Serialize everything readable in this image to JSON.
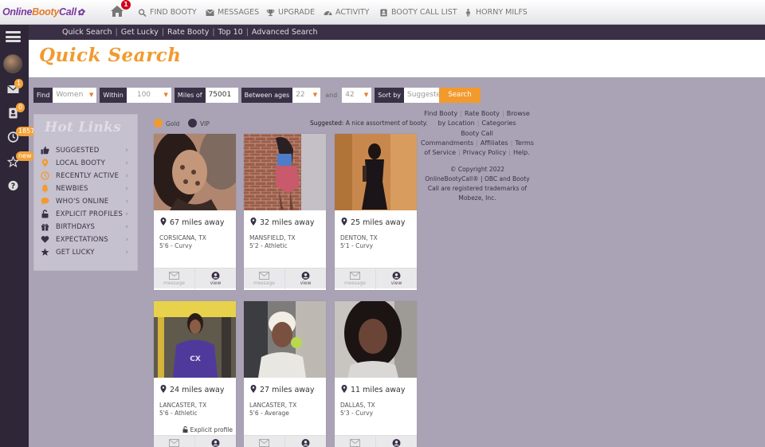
{
  "app": {
    "logo_part1": "Online",
    "logo_part2": "Booty",
    "logo_part3": "Call"
  },
  "topnav": {
    "home_badge": "1",
    "items": [
      "FIND BOOTY",
      "MESSAGES",
      "UPGRADE",
      "ACTIVITY",
      "BOOTY CALL LIST",
      "HORNY MILFS"
    ]
  },
  "sidebar": {
    "messages_badge": "1",
    "profile_badge": "0",
    "history_badge": "1857",
    "favorites_badge": "new"
  },
  "subnav": [
    "Quick Search",
    "Get Lucky",
    "Rate Booty",
    "Top 10",
    "Advanced Search"
  ],
  "page_title": "Quick Search",
  "filters": {
    "find_label": "Find",
    "find_value": "Women",
    "within_label": "Within",
    "within_value": "100",
    "miles_label": "Miles of",
    "zip_value": "75001",
    "ages_label": "Between ages",
    "age_min": "22",
    "and_label": "and",
    "age_max": "42",
    "sort_label": "Sort by",
    "sort_value": "Suggested",
    "search_button": "Search"
  },
  "hot_links": {
    "title": "Hot Links",
    "items": [
      {
        "label": "SUGGESTED",
        "icon": "thumbs-up-icon"
      },
      {
        "label": "LOCAL BOOTY",
        "icon": "map-pin-icon"
      },
      {
        "label": "RECENTLY ACTIVE",
        "icon": "clock-icon"
      },
      {
        "label": "NEWBIES",
        "icon": "bell-icon"
      },
      {
        "label": "WHO'S ONLINE",
        "icon": "chat-bubble-icon"
      },
      {
        "label": "EXPLICIT PROFILES",
        "icon": "unlock-icon"
      },
      {
        "label": "BIRTHDAYS",
        "icon": "gift-icon"
      },
      {
        "label": "EXPECTATIONS",
        "icon": "heart-icon"
      },
      {
        "label": "GET LUCKY",
        "icon": "star-icon"
      }
    ]
  },
  "legend": {
    "gold": "Gold",
    "vip": "VIP",
    "gold_color": "#f29a2e",
    "vip_color": "#3a3046"
  },
  "suggested_note": {
    "label": "Suggested:",
    "text": "A nice assortment of booty."
  },
  "profiles": [
    {
      "distance": "67 miles away",
      "city": "CORSICANA, TX",
      "stats": "5'6 - Curvy",
      "explicit": ""
    },
    {
      "distance": "32 miles away",
      "city": "MANSFIELD, TX",
      "stats": "5'2 - Athletic",
      "explicit": ""
    },
    {
      "distance": "25 miles away",
      "city": "DENTON, TX",
      "stats": "5'1 - Curvy",
      "explicit": ""
    },
    {
      "distance": "24 miles away",
      "city": "LANCASTER, TX",
      "stats": "5'6 - Athletic",
      "explicit": "Explicit profile"
    },
    {
      "distance": "27 miles away",
      "city": "LANCASTER, TX",
      "stats": "5'6 - Average",
      "explicit": ""
    },
    {
      "distance": "11 miles away",
      "city": "DALLAS, TX",
      "stats": "5'3 - Curvy",
      "explicit": ""
    }
  ],
  "card_actions": {
    "message": "message",
    "view": "view"
  },
  "footer": {
    "links": [
      "Find Booty",
      "Rate Booty",
      "Browse by Location",
      "Categories",
      "Booty Call Commandments",
      "Affiliates",
      "Terms of Service",
      "Privacy Policy",
      "Help."
    ],
    "copyright": "© Copyright 2022 OnlineBootyCall® | OBC and Booty Call are registered trademarks of Mobeze, Inc."
  }
}
